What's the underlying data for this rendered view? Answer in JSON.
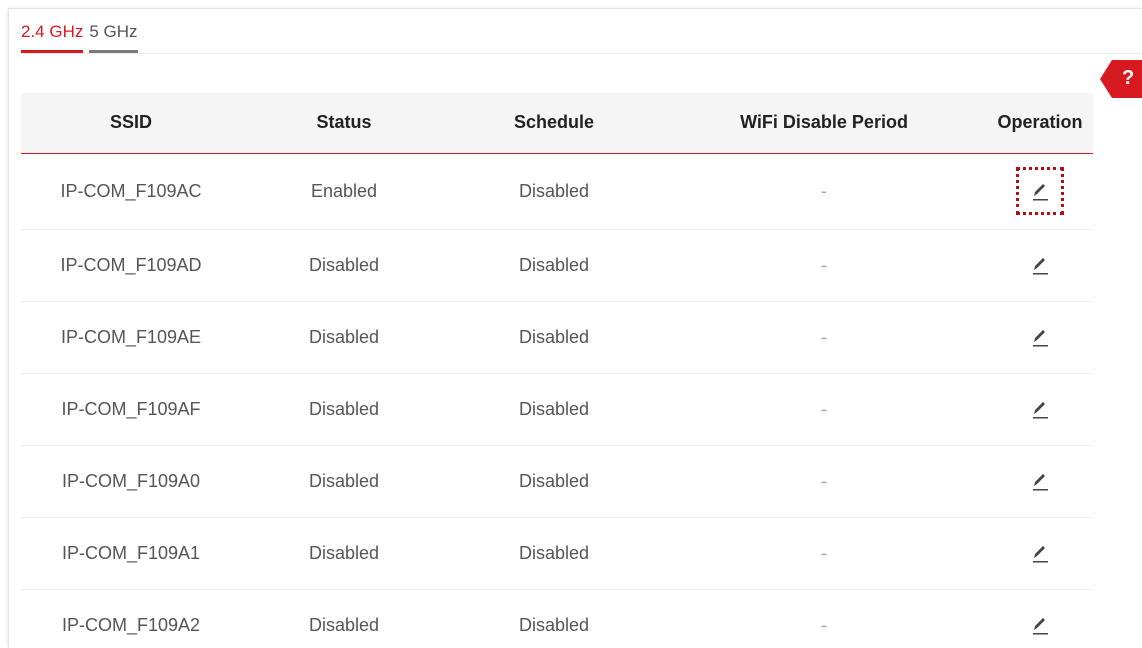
{
  "tabs": [
    {
      "label": "2.4 GHz",
      "active": true
    },
    {
      "label": "5 GHz",
      "active": false
    }
  ],
  "help": {
    "label": "?"
  },
  "table": {
    "headers": [
      "SSID",
      "Status",
      "Schedule",
      "WiFi Disable Period",
      "Operation"
    ],
    "rows": [
      {
        "ssid": "IP-COM_F109AC",
        "status": "Enabled",
        "schedule": "Disabled",
        "period": "-",
        "op_icon": "edit-icon"
      },
      {
        "ssid": "IP-COM_F109AD",
        "status": "Disabled",
        "schedule": "Disabled",
        "period": "-",
        "op_icon": "edit-icon"
      },
      {
        "ssid": "IP-COM_F109AE",
        "status": "Disabled",
        "schedule": "Disabled",
        "period": "-",
        "op_icon": "edit-icon"
      },
      {
        "ssid": "IP-COM_F109AF",
        "status": "Disabled",
        "schedule": "Disabled",
        "period": "-",
        "op_icon": "edit-icon"
      },
      {
        "ssid": "IP-COM_F109A0",
        "status": "Disabled",
        "schedule": "Disabled",
        "period": "-",
        "op_icon": "edit-icon"
      },
      {
        "ssid": "IP-COM_F109A1",
        "status": "Disabled",
        "schedule": "Disabled",
        "period": "-",
        "op_icon": "edit-icon"
      },
      {
        "ssid": "IP-COM_F109A2",
        "status": "Disabled",
        "schedule": "Disabled",
        "period": "-",
        "op_icon": "edit-icon"
      }
    ]
  },
  "colors": {
    "accent": "#d71920",
    "highlight": "#b01015",
    "header_bg": "#f5f5f5"
  }
}
